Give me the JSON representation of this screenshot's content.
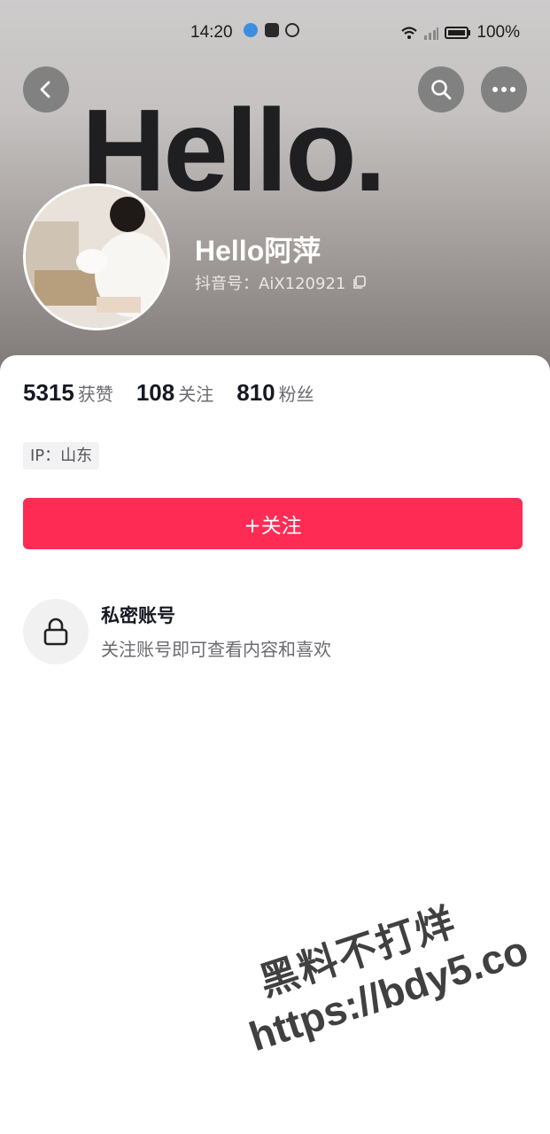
{
  "status_bar": {
    "time": "14:20",
    "battery": "100%"
  },
  "banner": {
    "text": "Hello."
  },
  "nav": {
    "back_icon": "chevron-left-icon",
    "search_icon": "search-icon",
    "more_icon": "more-horizontal-icon"
  },
  "profile": {
    "name": "Hello阿萍",
    "douyin_id": "抖音号：AiX120921"
  },
  "stats": [
    {
      "value": "5315",
      "label": "获赞"
    },
    {
      "value": "108",
      "label": "关注"
    },
    {
      "value": "810",
      "label": "粉丝"
    }
  ],
  "ip_location": "IP：山东",
  "follow_button": "+关注",
  "private_account": {
    "title": "私密账号",
    "description": "关注账号即可查看内容和喜欢"
  },
  "watermark": {
    "line1": "黑料不打烊",
    "line2": "https://bdy5.co"
  },
  "colors": {
    "accent": "#fe2c55",
    "text_primary": "#161823",
    "text_secondary": "#6b6b70"
  }
}
